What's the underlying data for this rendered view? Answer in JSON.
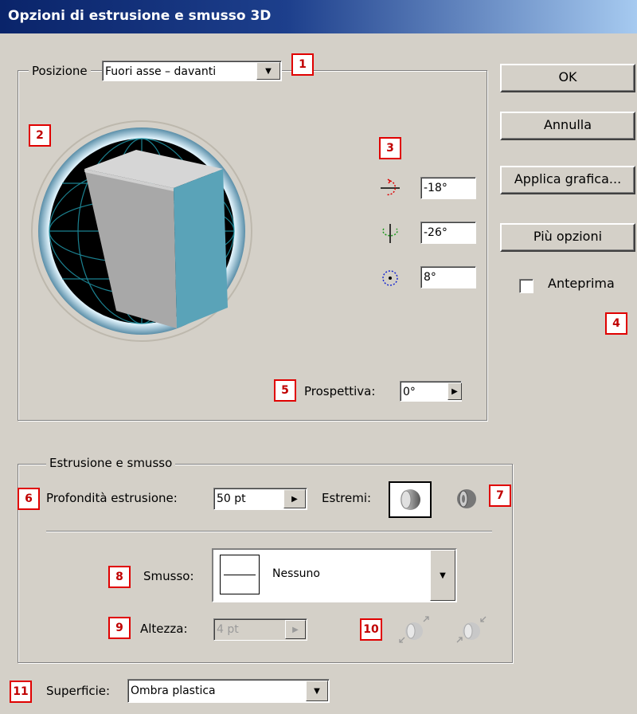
{
  "window": {
    "title": "Opzioni di estrusione e smusso 3D"
  },
  "position": {
    "legend": "Posizione",
    "preset_value": "Fuori asse – davanti",
    "rotation_x": "-18°",
    "rotation_y": "-26°",
    "rotation_z": "8°",
    "perspective_label": "Prospettiva:",
    "perspective_value": "0°"
  },
  "buttons": {
    "ok": "OK",
    "cancel": "Annulla",
    "map_art": "Applica grafica...",
    "more_options": "Più opzioni"
  },
  "preview": {
    "label": "Anteprima",
    "checked": false
  },
  "extrude": {
    "legend": "Estrusione e smusso",
    "depth_label": "Profondità estrusione:",
    "depth_value": "50 pt",
    "cap_label": "Estremi:",
    "bevel_label": "Smusso:",
    "bevel_value": "Nessuno",
    "height_label": "Altezza:",
    "height_value": "4 pt"
  },
  "surface": {
    "label": "Superficie:",
    "value": "Ombra plastica"
  },
  "callouts": [
    "1",
    "2",
    "3",
    "4",
    "5",
    "6",
    "7",
    "8",
    "9",
    "10",
    "11"
  ],
  "colors": {
    "callout_border": "#e00000",
    "cube_front": "#5fa6bb",
    "cube_top": "#cfcfcf",
    "cube_side": "#9a9a9a",
    "title_start": "#0a246a"
  }
}
